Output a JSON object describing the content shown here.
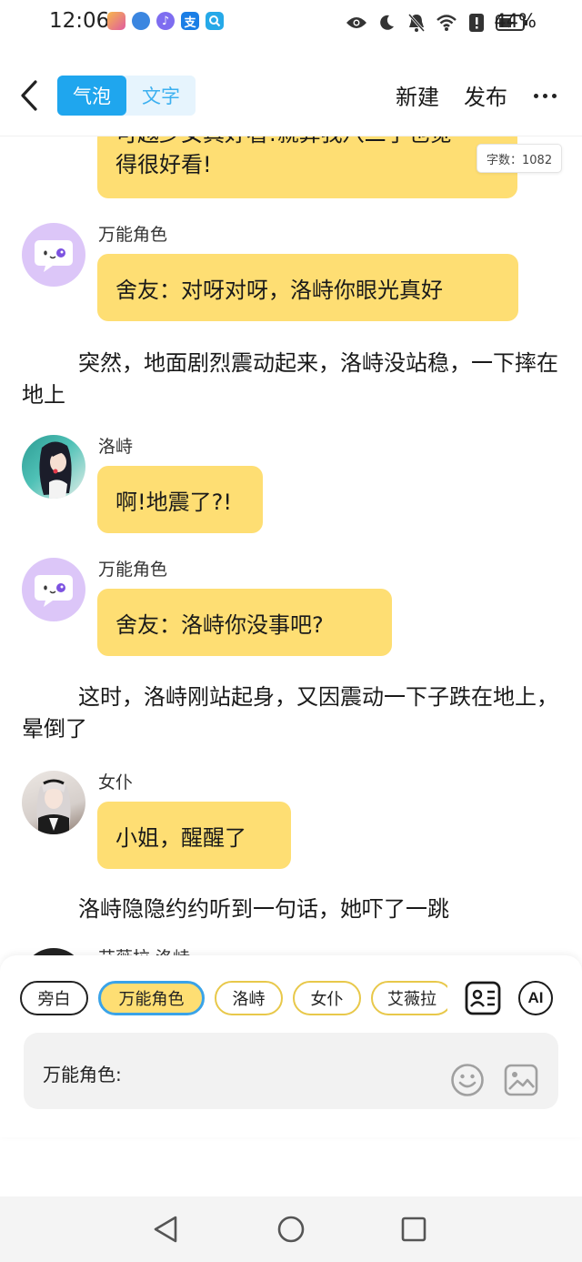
{
  "status_bar": {
    "time": "12:06",
    "battery": "44%",
    "icons": [
      "eye-icon",
      "moon-icon",
      "bell-off-icon",
      "wifi-icon",
      "alert-icon",
      "battery-icon"
    ],
    "app_icons": [
      {
        "name": "app-icon-1",
        "color": "#f0a64a",
        "glyph": ""
      },
      {
        "name": "app-icon-2",
        "color": "#3b86e0",
        "glyph": ""
      },
      {
        "name": "music-app-icon",
        "color": "#7e6df0",
        "glyph": "♪"
      },
      {
        "name": "alipay-icon",
        "color": "#1a7ee6",
        "glyph": "支"
      },
      {
        "name": "search-app-icon",
        "color": "#26a9e8",
        "glyph": ""
      }
    ]
  },
  "header": {
    "tabs": [
      {
        "label": "气泡",
        "active": true
      },
      {
        "label": "文字",
        "active": false
      }
    ],
    "new_label": "新建",
    "publish_label": "发布"
  },
  "chat": {
    "word_count": "字数：1082",
    "top_bubble_clipped": "可越少女真好看!就算我八二了也觉",
    "top_bubble_line2": "得很好看!",
    "messages": [
      {
        "type": "bubble",
        "speaker": "万能角色",
        "text": "舍友：对呀对呀，洛峙你眼光真好"
      },
      {
        "type": "narration",
        "text": "突然，地面剧烈震动起来，洛峙没站稳，一下摔在地上"
      },
      {
        "type": "bubble",
        "speaker": "洛峙",
        "text": "啊!地震了?!"
      },
      {
        "type": "bubble",
        "speaker": "万能角色",
        "text": "舍友：洛峙你没事吧?"
      },
      {
        "type": "narration",
        "text": "这时，洛峙刚站起身，又因震动一下子跌在地上，晕倒了"
      },
      {
        "type": "bubble",
        "speaker": "女仆",
        "text": "小姐，醒醒了"
      },
      {
        "type": "narration",
        "text": "洛峙隐隐约约听到一句话，她吓了一跳"
      },
      {
        "type": "bubble",
        "speaker": "艾薇拉 洛峙",
        "text": ""
      }
    ]
  },
  "composer": {
    "roles": [
      "旁白",
      "万能角色",
      "洛峙",
      "女仆",
      "艾薇拉"
    ],
    "selected_role": "万能角色",
    "ai_label": "AI",
    "input_label": "万能角色:"
  },
  "colors": {
    "bubble": "#fede73",
    "accent": "#1fa6ee",
    "avatar_universal": "#dcc6f8"
  }
}
